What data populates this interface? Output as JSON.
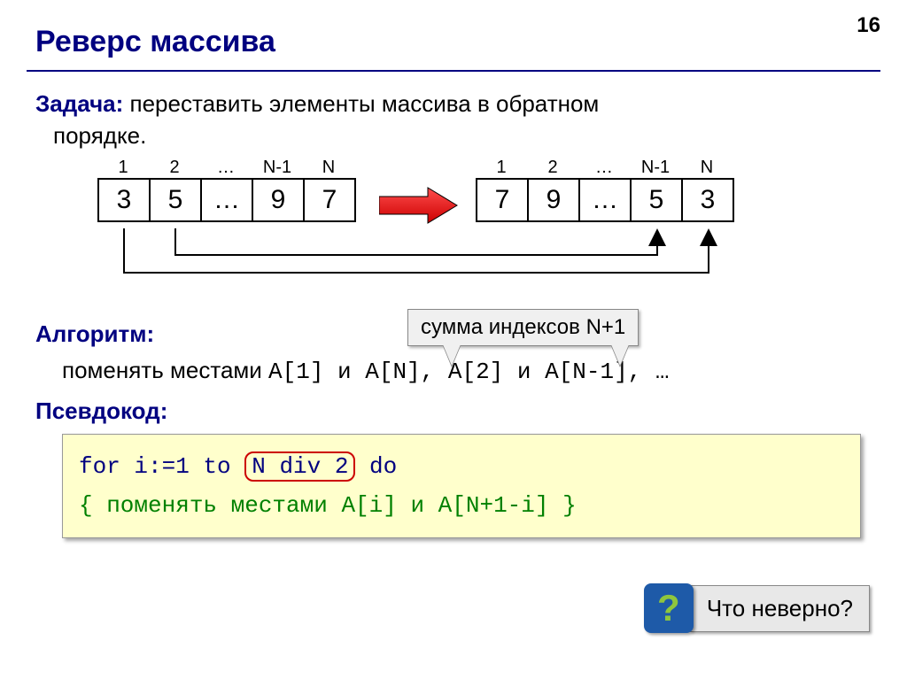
{
  "page_number": "16",
  "title": "Реверс массива",
  "task": {
    "label": "Задача:",
    "text_line1": " переставить элементы массива в обратном",
    "text_line2": "порядке."
  },
  "arrays": {
    "left": {
      "indices": [
        "1",
        "2",
        "…",
        "N-1",
        "N"
      ],
      "values": [
        "3",
        "5",
        "…",
        "9",
        "7"
      ]
    },
    "right": {
      "indices": [
        "1",
        "2",
        "…",
        "N-1",
        "N"
      ],
      "values": [
        "7",
        "9",
        "…",
        "5",
        "3"
      ]
    }
  },
  "callout": "сумма индексов N+1",
  "algorithm": {
    "label": "Алгоритм:",
    "text_prefix": "поменять местами ",
    "code_part": "A[1] и A[N], A[2] и A[N-1], …"
  },
  "pseudocode": {
    "label": "Псевдокод:",
    "line1_a": "for i:=1 to ",
    "line1_box": "N div 2",
    "line1_b": " do",
    "line2": " { поменять местами A[i] и A[N+1-i] }"
  },
  "question": {
    "icon": "?",
    "text": "Что неверно?"
  }
}
